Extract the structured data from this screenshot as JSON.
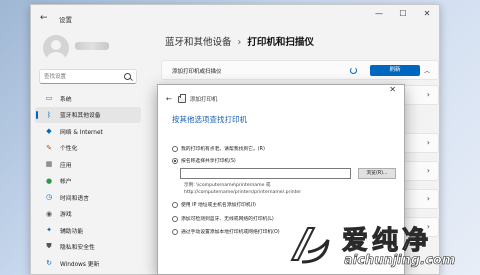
{
  "window": {
    "back": "←",
    "title": "设置",
    "controls": [
      "—",
      "☐",
      "✕"
    ]
  },
  "sidebar": {
    "search_placeholder": "查找设置",
    "items": [
      {
        "label": "系统",
        "icon": "system-icon",
        "color": "#0067c0"
      },
      {
        "label": "蓝牙和其他设备",
        "icon": "bluetooth-icon",
        "color": "#0067c0",
        "active": true
      },
      {
        "label": "网络 & Internet",
        "icon": "network-icon",
        "color": "#0067c0"
      },
      {
        "label": "个性化",
        "icon": "brush-icon",
        "color": "#c25100"
      },
      {
        "label": "应用",
        "icon": "apps-icon",
        "color": "#555555"
      },
      {
        "label": "帐户",
        "icon": "account-icon",
        "color": "#2b9a4a"
      },
      {
        "label": "时间和语言",
        "icon": "time-language-icon",
        "color": "#0067c0"
      },
      {
        "label": "游戏",
        "icon": "game-icon",
        "color": "#555555"
      },
      {
        "label": "辅助功能",
        "icon": "accessibility-icon",
        "color": "#0067c0"
      },
      {
        "label": "隐私和安全性",
        "icon": "shield-icon",
        "color": "#555555"
      },
      {
        "label": "Windows 更新",
        "icon": "update-icon",
        "color": "#0067c0"
      }
    ]
  },
  "main": {
    "breadcrumb_parent": "蓝牙和其他设备",
    "breadcrumb_sep": "›",
    "breadcrumb_current": "打印机和扫描仪",
    "add_label": "添加打印机或扫描仪",
    "refresh_label": "刷新"
  },
  "dialog": {
    "close": "✕",
    "title": "添加打印机",
    "heading": "按其他选项查找打印机",
    "options": [
      {
        "label": "我的打印机有点老。请帮我找到它。(R)",
        "selected": false
      },
      {
        "label": "按名称选择共享打印机(S)",
        "selected": true
      },
      {
        "label": "使用 IP 地址或主机名添加打印机(I)",
        "selected": false
      },
      {
        "label": "添加可检测到蓝牙、无线或网络的打印机(L)",
        "selected": false
      },
      {
        "label": "通过手动设置添加本地打印机或网络打印机(O)",
        "selected": false
      }
    ],
    "browse_label": "浏览(R)...",
    "example_line1": "示例: \\\\computername\\printername 或",
    "example_line2": "http://computername/printers/printername/.printer"
  },
  "watermark": {
    "text_cn": "爱纯净",
    "url": "aichunjing.com"
  }
}
